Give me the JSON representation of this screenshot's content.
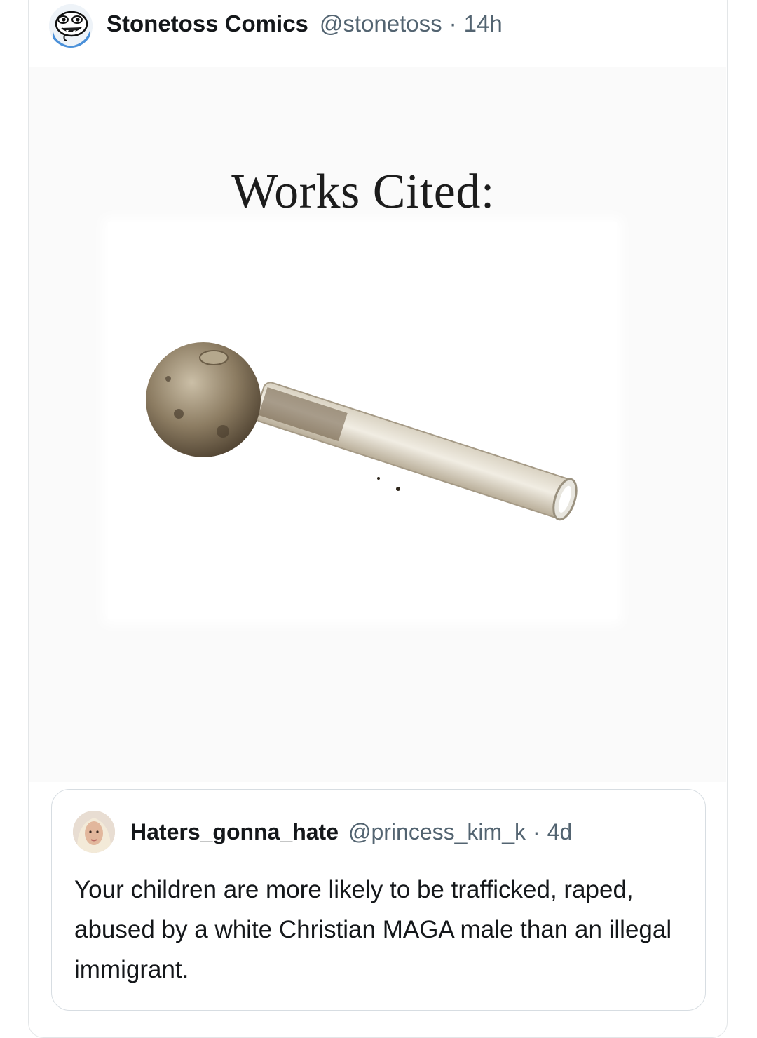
{
  "post": {
    "author_name": "Stonetoss Comics",
    "author_handle": "@stonetoss",
    "separator": "·",
    "time": "14h",
    "avatar_icon": "cartoon-face-avatar"
  },
  "media": {
    "title": "Works Cited:",
    "image_icon": "glass-pipe-image"
  },
  "quoted_post": {
    "author_name": "Haters_gonna_hate",
    "author_handle": "@princess_kim_k",
    "separator": "·",
    "time": "4d",
    "avatar_icon": "profile-photo-avatar",
    "text": "Your children are more likely to be trafficked, raped, abused by a white Christian MAGA male than an illegal immigrant."
  },
  "colors": {
    "text_primary": "#14171a",
    "text_secondary": "#536471",
    "border": "#d7dde2",
    "avatar_blue": "#4a90d9"
  }
}
